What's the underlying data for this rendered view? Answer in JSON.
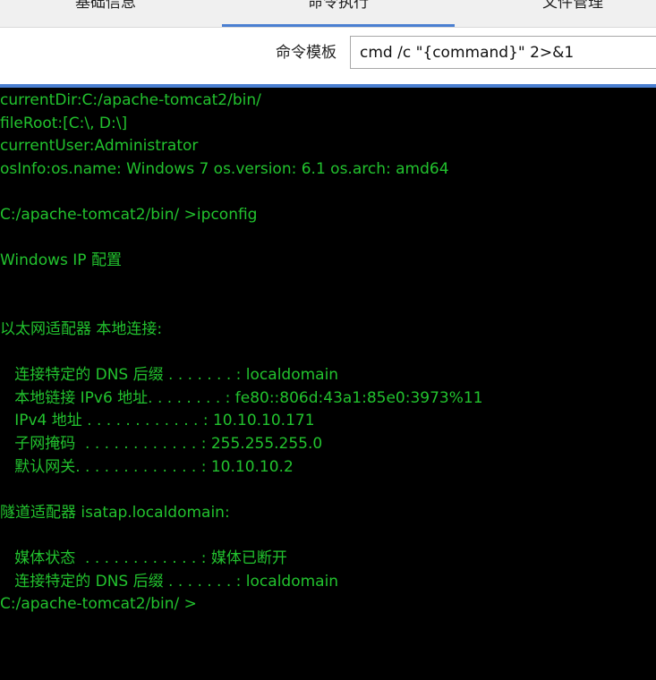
{
  "tabs": [
    {
      "label": "基础信息",
      "active": false
    },
    {
      "label": "命令执行",
      "active": true
    },
    {
      "label": "文件管理",
      "active": false
    }
  ],
  "toolbar": {
    "template_label": "命令模板",
    "template_value": "cmd /c \"{command}\" 2>&1"
  },
  "colors": {
    "terminal_text": "#22c22e",
    "terminal_bg": "#000000",
    "accent": "#4a7fd1"
  },
  "terminal": {
    "lines": [
      "currentDir:C:/apache-tomcat2/bin/",
      "fileRoot:[C:\\, D:\\]",
      "currentUser:Administrator",
      "osInfo:os.name: Windows 7 os.version: 6.1 os.arch: amd64",
      "",
      "C:/apache-tomcat2/bin/ >ipconfig",
      "",
      "Windows IP 配置",
      "",
      "",
      "以太网适配器 本地连接:",
      "",
      "   连接特定的 DNS 后缀 . . . . . . . : localdomain",
      "   本地链接 IPv6 地址. . . . . . . . : fe80::806d:43a1:85e0:3973%11",
      "   IPv4 地址 . . . . . . . . . . . . : 10.10.10.171",
      "   子网掩码  . . . . . . . . . . . . : 255.255.255.0",
      "   默认网关. . . . . . . . . . . . . : 10.10.10.2",
      "",
      "隧道适配器 isatap.localdomain:",
      "",
      "   媒体状态  . . . . . . . . . . . . : 媒体已断开",
      "   连接特定的 DNS 后缀 . . . . . . . : localdomain",
      "C:/apache-tomcat2/bin/ >"
    ]
  }
}
